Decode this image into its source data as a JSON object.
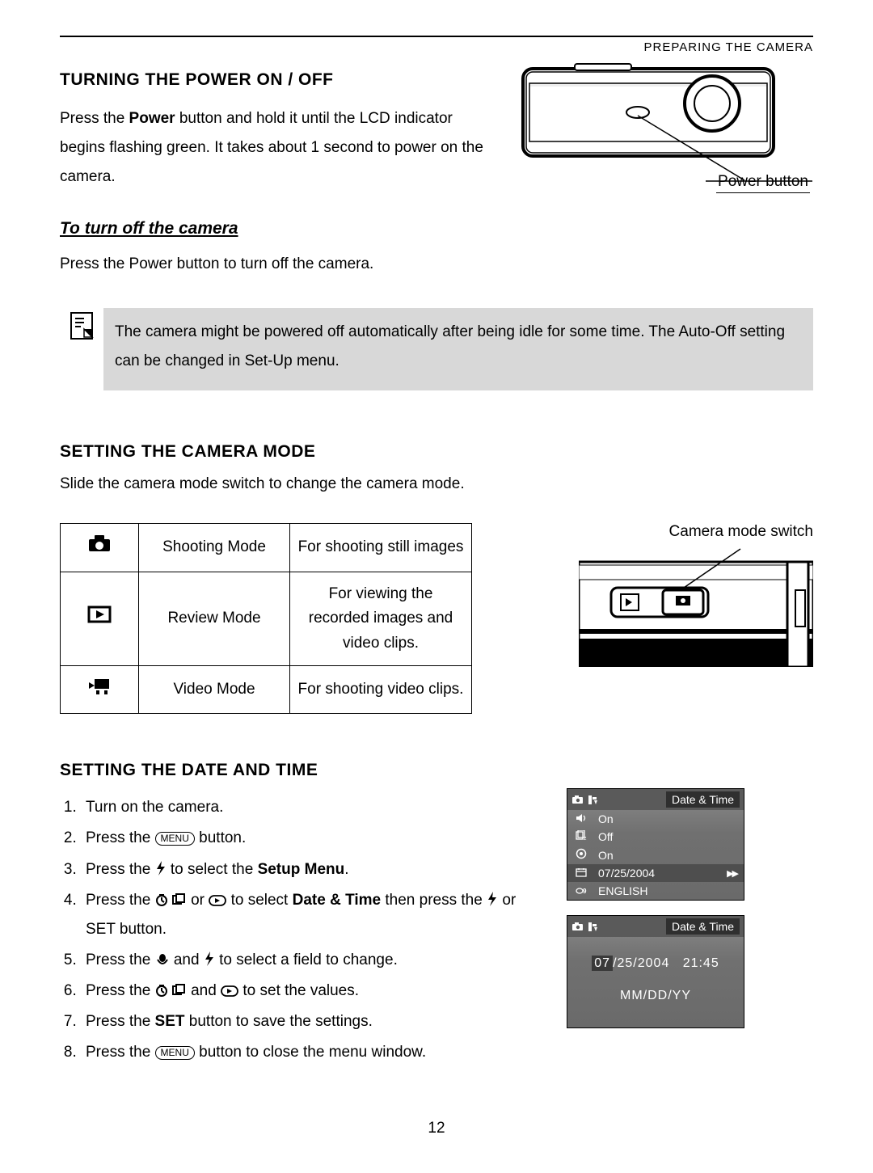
{
  "header_label": "PREPARING THE CAMERA",
  "section1": {
    "title": "TURNING THE POWER ON / OFF",
    "para_a": "Press the ",
    "para_bold": "Power",
    "para_b": " button and hold it until the LCD indicator begins flashing green. It takes about 1 second to power on the camera.",
    "diagram_label": "Power button",
    "sub_title": "To turn off the camera",
    "sub_text": "Press the Power button to turn off the camera.",
    "note_text": "The camera might be powered off automatically after being idle for some time. The Auto-Off setting can be changed in Set-Up menu."
  },
  "section2": {
    "title": "SETTING THE CAMERA MODE",
    "intro": "Slide the camera mode switch to change the camera mode.",
    "table": [
      {
        "name": "Shooting Mode",
        "desc": "For shooting still images"
      },
      {
        "name": "Review Mode",
        "desc": "For viewing the recorded images and video clips."
      },
      {
        "name": "Video Mode",
        "desc": "For shooting video clips."
      }
    ],
    "switch_label": "Camera mode switch"
  },
  "section3": {
    "title": "SETTING THE DATE AND TIME",
    "steps": {
      "s1": "Turn on the camera.",
      "s2a": "Press the ",
      "s2b": " button.",
      "s3a": "Press the ",
      "s3b": " to select the ",
      "s3bold": "Setup Menu",
      "s3c": ".",
      "s4a": "Press the ",
      "s4b": " or ",
      "s4c": " to select ",
      "s4bold": "Date & Time",
      "s4d": " then press the ",
      "s4e": " or SET button.",
      "s5a": "Press the ",
      "s5b": " and ",
      "s5c": " to select a field to change.",
      "s6a": "Press the ",
      "s6b": " and ",
      "s6c": " to set the values.",
      "s7a": "Press the ",
      "s7bold": "SET",
      "s7b": " button to save the settings.",
      "s8a": "Press the ",
      "s8b": " button to close the menu window."
    },
    "menu_label": "MENU"
  },
  "screens": {
    "title": "Date & Time",
    "rows": [
      {
        "value": "On"
      },
      {
        "value": "Off"
      },
      {
        "value": "On"
      },
      {
        "value": "07/25/2004"
      },
      {
        "value": "ENGLISH"
      }
    ],
    "s2_date": "07/25/2004",
    "s2_date_hl": "07",
    "s2_date_rest": "/25/2004",
    "s2_time": "21:45",
    "s2_fmt": "MM/DD/YY"
  },
  "page_number": "12"
}
